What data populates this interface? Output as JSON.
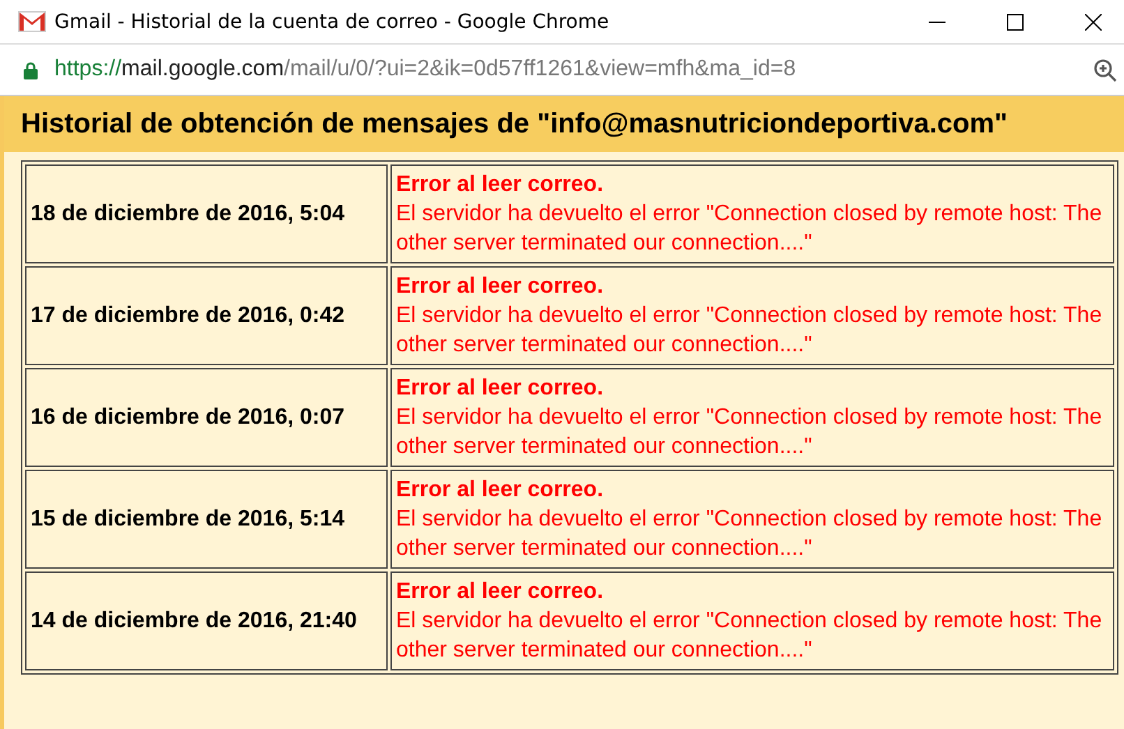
{
  "window": {
    "title": "Gmail - Historial de la cuenta de correo - Google Chrome"
  },
  "address_bar": {
    "scheme": "https://",
    "host": "mail.google.com",
    "path": "/mail/u/0/?ui=2&ik=0d57ff1261&view=mfh&ma_id=8"
  },
  "heading": "Historial de obtención de mensajes de \"info@masnutriciondeportiva.com\"",
  "rows": [
    {
      "date": "18 de diciembre de 2016, 5:04",
      "error_title": "Error al leer correo.",
      "error_detail": "El servidor ha devuelto el error \"Connection closed by remote host: The other server terminated our connection....\""
    },
    {
      "date": "17 de diciembre de 2016, 0:42",
      "error_title": "Error al leer correo.",
      "error_detail": "El servidor ha devuelto el error \"Connection closed by remote host: The other server terminated our connection....\""
    },
    {
      "date": "16 de diciembre de 2016, 0:07",
      "error_title": "Error al leer correo.",
      "error_detail": "El servidor ha devuelto el error \"Connection closed by remote host: The other server terminated our connection....\""
    },
    {
      "date": "15 de diciembre de 2016, 5:14",
      "error_title": "Error al leer correo.",
      "error_detail": "El servidor ha devuelto el error \"Connection closed by remote host: The other server terminated our connection....\""
    },
    {
      "date": "14 de diciembre de 2016, 21:40",
      "error_title": "Error al leer correo.",
      "error_detail": "El servidor ha devuelto el error \"Connection closed by remote host: The other server terminated our connection....\""
    }
  ]
}
